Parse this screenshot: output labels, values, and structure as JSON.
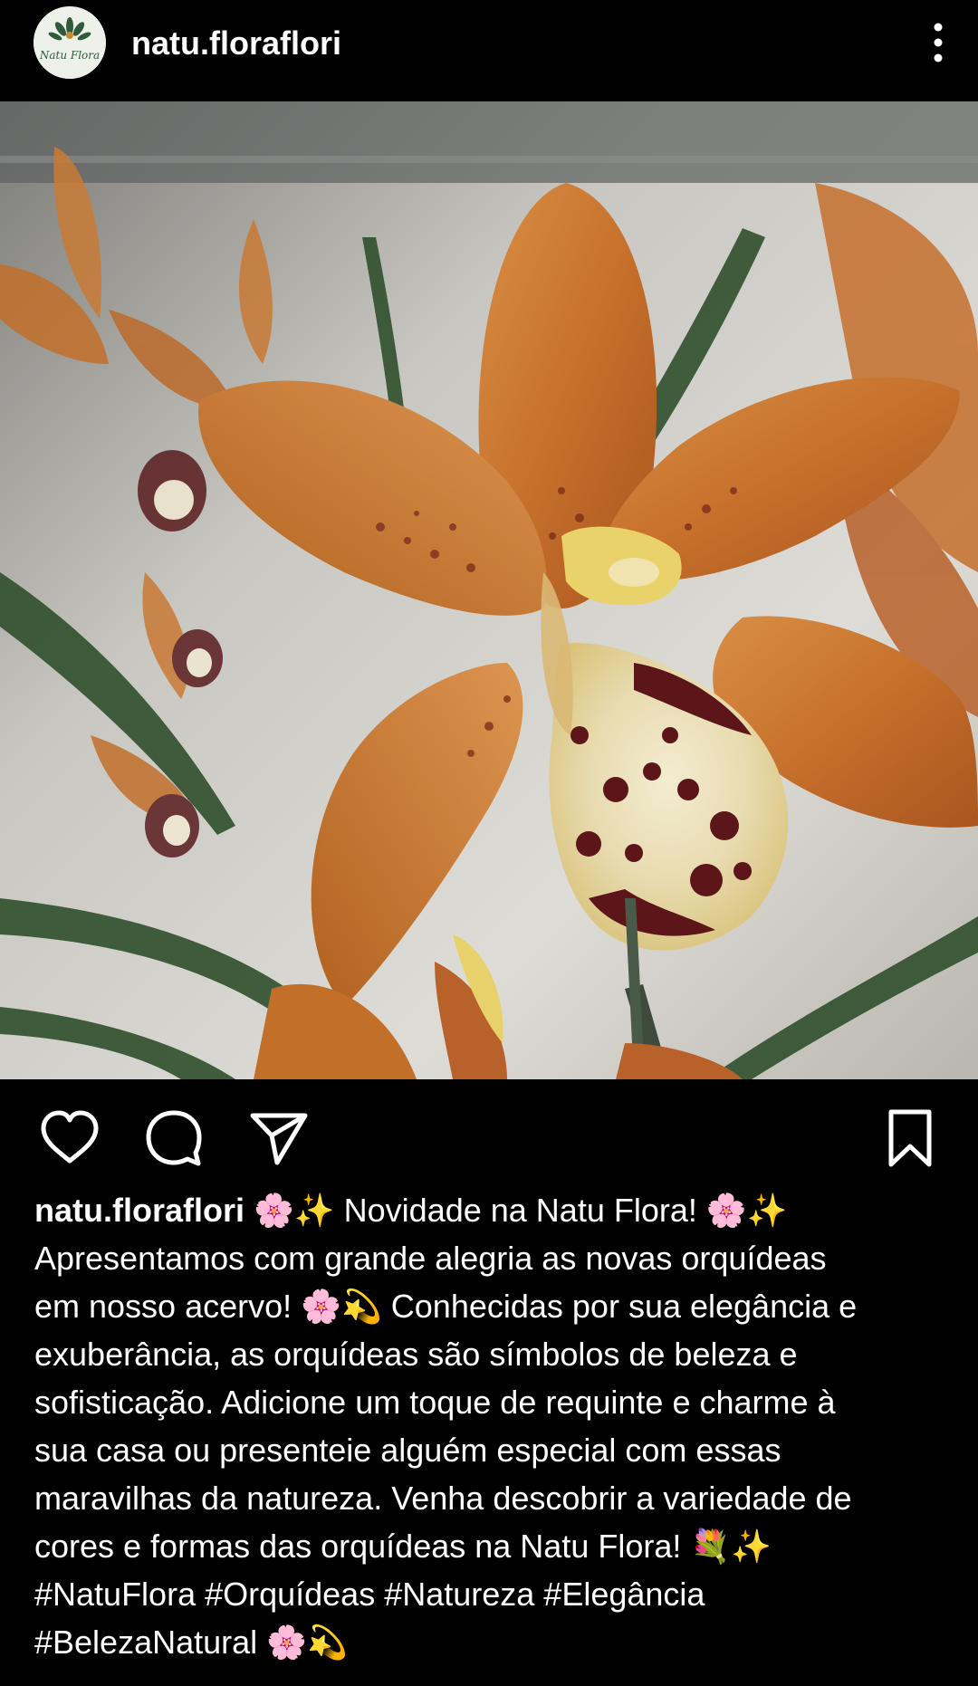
{
  "header": {
    "username": "natu.floraflori",
    "avatar_text": "Natu Flora",
    "menu_icon": "more-vertical-icon"
  },
  "post": {
    "image_alt": "Orange cymbidium orchids",
    "actions": {
      "like_icon": "heart-icon",
      "comment_icon": "comment-bubble-icon",
      "share_icon": "paper-plane-icon",
      "save_icon": "bookmark-icon"
    },
    "caption": {
      "username": "natu.floraflori",
      "lines": [
        " 🌸✨ Novidade na Natu Flora! 🌸✨",
        "Apresentamos com grande alegria as novas orquídeas",
        "em nosso acervo! 🌸💫 Conhecidas por sua elegância e",
        "exuberância, as orquídeas são símbolos de beleza e",
        "sofisticação. Adicione um toque de requinte e charme à",
        "sua casa ou presenteie alguém especial com essas",
        "maravilhas da natureza. Venha descobrir a variedade de",
        "cores e formas das orquídeas na Natu Flora! 💐✨",
        "#NatuFlora #Orquídeas #Natureza #Elegância",
        "#BelezaNatural 🌸💫"
      ]
    }
  }
}
